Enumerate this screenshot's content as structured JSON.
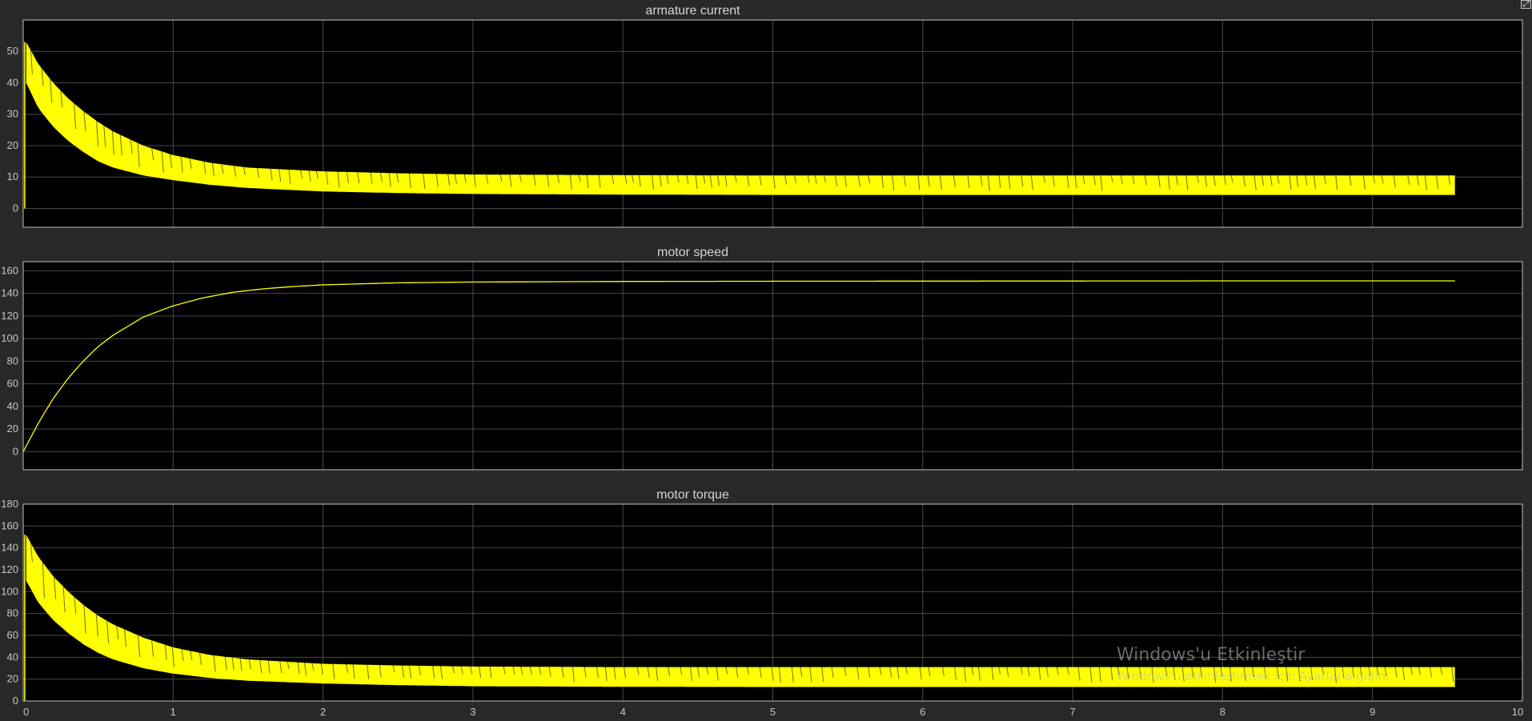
{
  "window": {
    "corner_button_icon": "undock-icon",
    "corner_button_glyph": "⤢"
  },
  "watermark": {
    "title": "Windows'u Etkinleştir",
    "subtitle": "Windows'u etkinleştirmek için Ayarlar'a gidin."
  },
  "colors": {
    "background": "#282828",
    "axes_bg": "#000000",
    "grid": "#4a4a4a",
    "signal": "#ffff00",
    "frame": "#c0c0c0"
  },
  "chart_data": [
    {
      "type": "line",
      "title": "armature current",
      "xlim": [
        0,
        10
      ],
      "ylim": [
        -6,
        60
      ],
      "x_ticks": [
        0,
        1,
        2,
        3,
        4,
        5,
        6,
        7,
        8,
        9,
        10
      ],
      "x_tick_labels": [
        "",
        "",
        "",
        "",
        "",
        "",
        "",
        "",
        "",
        "",
        ""
      ],
      "y_ticks": [
        0,
        10,
        20,
        30,
        40,
        50
      ],
      "y_tick_labels": [
        "0",
        "10",
        "20",
        "30",
        "40",
        "50"
      ],
      "grid": true,
      "series": [
        {
          "style": "ripple band",
          "x": [
            0.02,
            0.1,
            0.2,
            0.3,
            0.4,
            0.5,
            0.6,
            0.8,
            1.0,
            1.25,
            1.5,
            2.0,
            2.5,
            3.0,
            4.0,
            5.0,
            6.0,
            7.0,
            8.0,
            9.0,
            9.55
          ],
          "upper": [
            53,
            46,
            40,
            35,
            31,
            27.5,
            24.5,
            20,
            17,
            14.5,
            13,
            11.8,
            11.2,
            10.8,
            10.6,
            10.5,
            10.5,
            10.5,
            10.5,
            10.5,
            10.5
          ],
          "lower": [
            40,
            32,
            26,
            21.5,
            18,
            15,
            13,
            10.5,
            9,
            7.5,
            6.5,
            5.4,
            4.9,
            4.6,
            4.4,
            4.3,
            4.3,
            4.3,
            4.3,
            4.3,
            4.3
          ]
        }
      ]
    },
    {
      "type": "line",
      "title": "motor speed",
      "xlim": [
        0,
        10
      ],
      "ylim": [
        -16,
        168
      ],
      "x_ticks": [
        0,
        1,
        2,
        3,
        4,
        5,
        6,
        7,
        8,
        9,
        10
      ],
      "x_tick_labels": [
        "",
        "",
        "",
        "",
        "",
        "",
        "",
        "",
        "",
        "",
        ""
      ],
      "y_ticks": [
        0,
        20,
        40,
        60,
        80,
        100,
        120,
        140,
        160
      ],
      "y_tick_labels": [
        "0",
        "20",
        "40",
        "60",
        "80",
        "100",
        "120",
        "140",
        "160"
      ],
      "grid": true,
      "series": [
        {
          "x": [
            0,
            0.1,
            0.2,
            0.3,
            0.4,
            0.5,
            0.6,
            0.8,
            1.0,
            1.2,
            1.4,
            1.6,
            1.8,
            2.0,
            2.5,
            3.0,
            4.0,
            5.0,
            6.0,
            7.0,
            8.0,
            9.0,
            9.55
          ],
          "y": [
            0,
            25,
            47,
            65,
            80,
            93,
            103,
            119,
            129,
            136,
            141,
            144,
            146,
            147.5,
            149.3,
            150,
            150.5,
            150.7,
            150.8,
            150.9,
            151,
            151,
            151
          ]
        }
      ]
    },
    {
      "type": "line",
      "title": "motor torque",
      "xlim": [
        0,
        10
      ],
      "ylim": [
        0,
        180
      ],
      "x_ticks": [
        0,
        1,
        2,
        3,
        4,
        5,
        6,
        7,
        8,
        9,
        10
      ],
      "x_tick_labels": [
        "0",
        "1",
        "2",
        "3",
        "4",
        "5",
        "6",
        "7",
        "8",
        "9",
        "10"
      ],
      "y_ticks": [
        0,
        20,
        40,
        60,
        80,
        100,
        120,
        140,
        160,
        180
      ],
      "y_tick_labels": [
        "0",
        "20",
        "40",
        "60",
        "80",
        "100",
        "120",
        "140",
        "160",
        "180"
      ],
      "grid": true,
      "series": [
        {
          "style": "ripple band",
          "x": [
            0.02,
            0.1,
            0.2,
            0.3,
            0.4,
            0.5,
            0.6,
            0.8,
            1.0,
            1.25,
            1.5,
            2.0,
            2.5,
            3.0,
            4.0,
            5.0,
            6.0,
            7.0,
            8.0,
            9.0,
            9.55
          ],
          "upper": [
            152,
            132,
            114,
            100,
            88,
            78,
            70,
            58,
            49,
            42,
            38,
            34,
            32.5,
            31.5,
            31,
            31,
            31,
            31,
            31,
            31,
            31
          ],
          "lower": [
            110,
            90,
            74,
            62,
            52,
            44,
            38,
            30,
            25,
            21,
            18.5,
            16,
            14.5,
            13.5,
            13,
            12.8,
            12.8,
            12.8,
            12.8,
            12.8,
            12.8
          ]
        }
      ]
    }
  ]
}
